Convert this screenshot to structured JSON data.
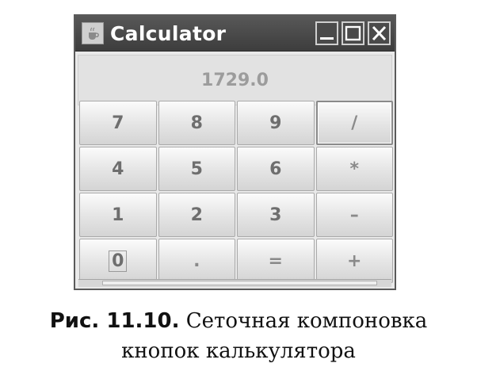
{
  "window": {
    "title": "Calculator",
    "icon": "java-cup-icon",
    "controls": [
      {
        "name": "minimize",
        "icon": "minimize-icon"
      },
      {
        "name": "maximize",
        "icon": "maximize-icon"
      },
      {
        "name": "close",
        "icon": "close-icon"
      }
    ]
  },
  "display": {
    "value": "1729.0"
  },
  "keypad": {
    "keys": [
      "7",
      "8",
      "9",
      "/",
      "4",
      "5",
      "6",
      "*",
      "1",
      "2",
      "3",
      "–",
      "0",
      ".",
      "=",
      "+"
    ],
    "focused_key": "/",
    "focus_ring_key": "0"
  },
  "caption": {
    "lead": "Рис. 11.10.",
    "text_line1": "Сеточная компоновка",
    "text_line2": "кнопок калькулятора"
  },
  "colors": {
    "titlebar": "#4a4a4a",
    "window_bg": "#e9e9e9",
    "key_text": "#6e6e6e",
    "display_text": "#9c9c9c"
  }
}
